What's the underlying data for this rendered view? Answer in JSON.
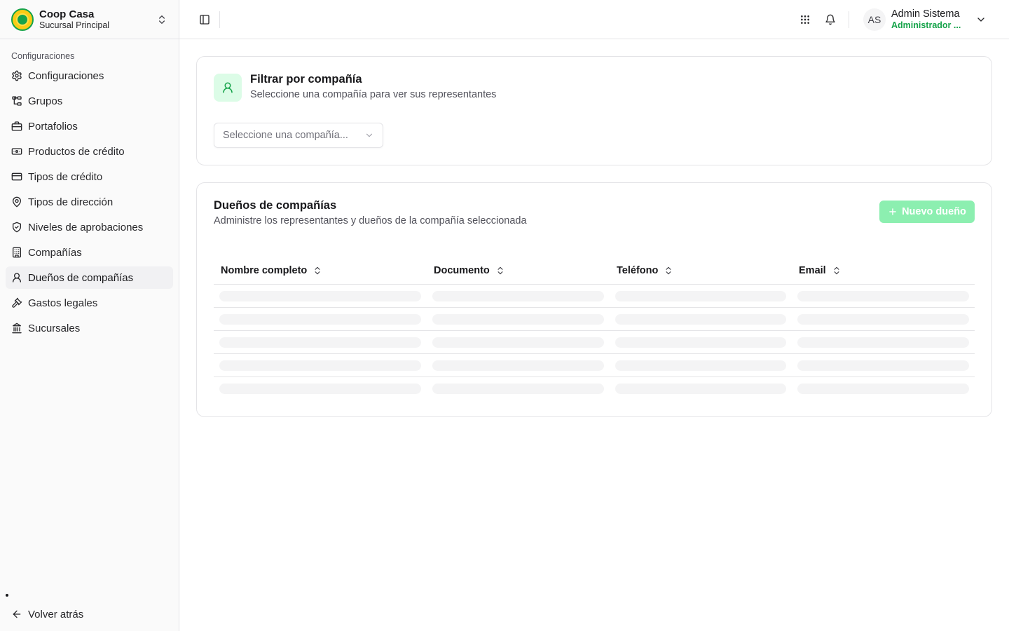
{
  "org": {
    "name": "Coop Casa",
    "branch": "Sucursal Principal"
  },
  "sidebar": {
    "group_label": "Configuraciones",
    "items": [
      {
        "label": "Configuraciones",
        "icon": "gear-icon"
      },
      {
        "label": "Grupos",
        "icon": "network-icon"
      },
      {
        "label": "Portafolios",
        "icon": "briefcase-icon"
      },
      {
        "label": "Productos de crédito",
        "icon": "banknote-icon"
      },
      {
        "label": "Tipos de crédito",
        "icon": "credit-card-icon"
      },
      {
        "label": "Tipos de dirección",
        "icon": "map-pin-icon"
      },
      {
        "label": "Niveles de aprobaciones",
        "icon": "shield-check-icon"
      },
      {
        "label": "Compañías",
        "icon": "building-icon"
      },
      {
        "label": "Dueños de compañías",
        "icon": "user-icon",
        "active": true
      },
      {
        "label": "Gastos legales",
        "icon": "gavel-icon"
      },
      {
        "label": "Sucursales",
        "icon": "landmark-icon"
      }
    ],
    "back_label": "Volver atrás"
  },
  "header": {
    "user_initials": "AS",
    "user_name": "Admin Sistema",
    "user_role": "Administrador ..."
  },
  "filter_card": {
    "title": "Filtrar por compañía",
    "subtitle": "Seleccione una compañía para ver sus representantes",
    "select_placeholder": "Seleccione una compañía..."
  },
  "owners_card": {
    "title": "Dueños de compañías",
    "subtitle": "Administre los representantes y dueños de la compañía seleccionada",
    "new_button": "Nuevo dueño",
    "columns": [
      "Nombre completo",
      "Documento",
      "Teléfono",
      "Email"
    ],
    "loading_rows": 5
  },
  "colors": {
    "accent": "#16a34a",
    "accent_light": "#dcfce7",
    "button_disabled": "#86efac"
  }
}
